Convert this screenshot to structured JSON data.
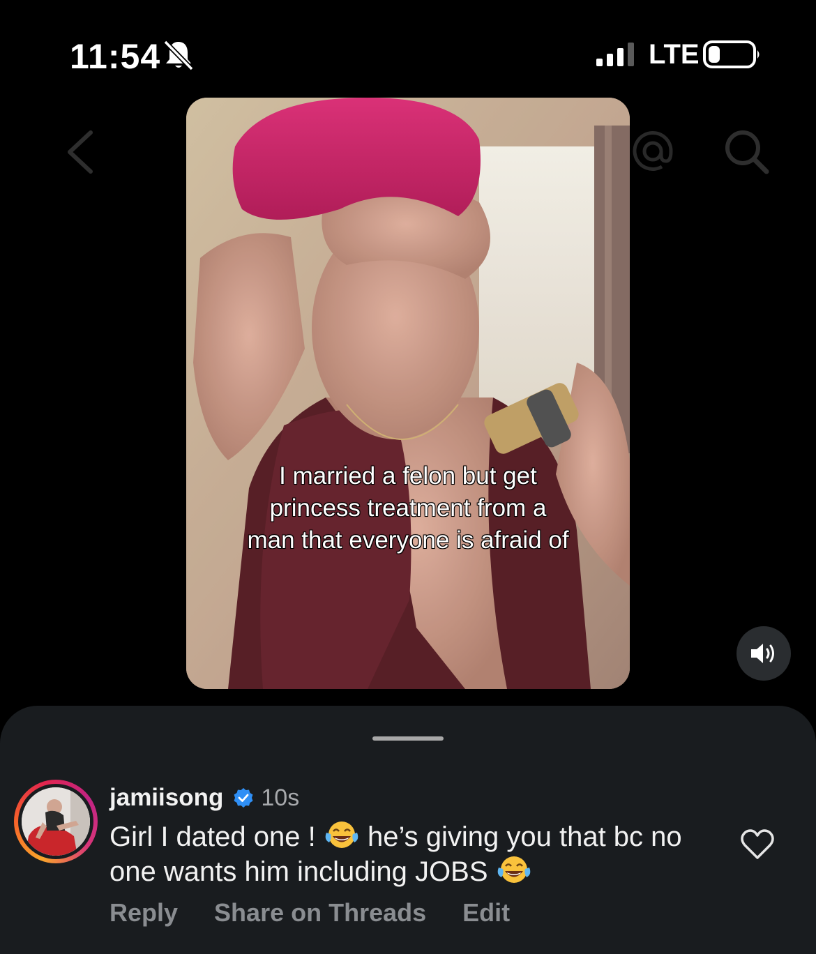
{
  "status_bar": {
    "time": "11:54",
    "network": "LTE"
  },
  "icons": {
    "bell": "bell-off-icon",
    "signal": "signal-icon",
    "battery": "battery-icon",
    "back": "chevron-left-icon",
    "mention": "mention-icon",
    "search": "search-icon",
    "sound": "speaker-icon",
    "verified": "verified-badge-icon",
    "like": "heart-icon",
    "emoji": "laughing-tears-emoji"
  },
  "video": {
    "caption_lines": [
      "I married a felon but get",
      "princess treatment from a",
      "man that everyone is afraid of"
    ]
  },
  "comment": {
    "username": "jamiisong",
    "time": "10s",
    "text_part1": "Girl I dated one ! ",
    "text_part2": " he’s giving you that bc no one wants him including JOBS ",
    "actions": {
      "reply": "Reply",
      "share": "Share on Threads",
      "edit": "Edit"
    }
  },
  "colors": {
    "background": "#000000",
    "sheet": "#191c1f",
    "muted_text": "#8a8d91",
    "verified_blue": "#2f8ff5"
  }
}
